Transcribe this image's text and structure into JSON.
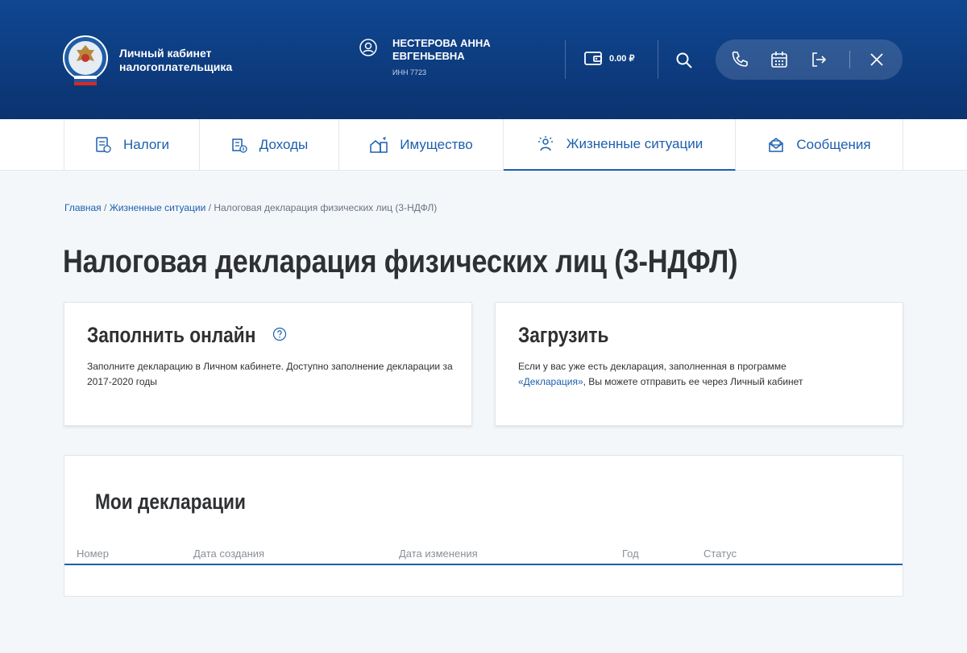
{
  "header": {
    "brand_line1": "Личный кабинет",
    "brand_line2": "налогоплательщика",
    "user_name_line1": "НЕСТЕРОВА АННА",
    "user_name_line2": "ЕВГЕНЬЕВНА",
    "user_inn": "ИНН 7723",
    "balance": "0.00 ₽",
    "colors": {
      "header_bg": "#0f4790",
      "accent": "#1d5fad"
    }
  },
  "tabs": [
    {
      "label": "Налоги",
      "icon": "taxes-icon"
    },
    {
      "label": "Доходы",
      "icon": "income-icon"
    },
    {
      "label": "Имущество",
      "icon": "property-icon"
    },
    {
      "label": "Жизненные ситуации",
      "icon": "life-situations-icon",
      "active": true
    },
    {
      "label": "Сообщения",
      "icon": "messages-icon"
    }
  ],
  "breadcrumb": {
    "home": "Главная",
    "sep1": " / ",
    "section": "Жизненные ситуации",
    "sep2": " / ",
    "current": "Налоговая декларация физических лиц (3-НДФЛ)"
  },
  "page_title": "Налоговая декларация физических лиц (3-НДФЛ)",
  "fill_online": {
    "title": "Заполнить онлайн",
    "text": "Заполните декларацию в Личном кабинете. Доступно заполнение декларации за 2017-2020 годы"
  },
  "upload": {
    "title": "Загрузить",
    "text_before": "Если у вас уже есть декларация, заполненная в программе ",
    "link": "«Декларация»",
    "text_after": ", Вы можете отправить ее через Личный кабинет"
  },
  "declarations": {
    "title": "Мои декларации",
    "columns": [
      "Номер",
      "Дата создания",
      "Дата изменения",
      "Год",
      "Статус"
    ]
  }
}
